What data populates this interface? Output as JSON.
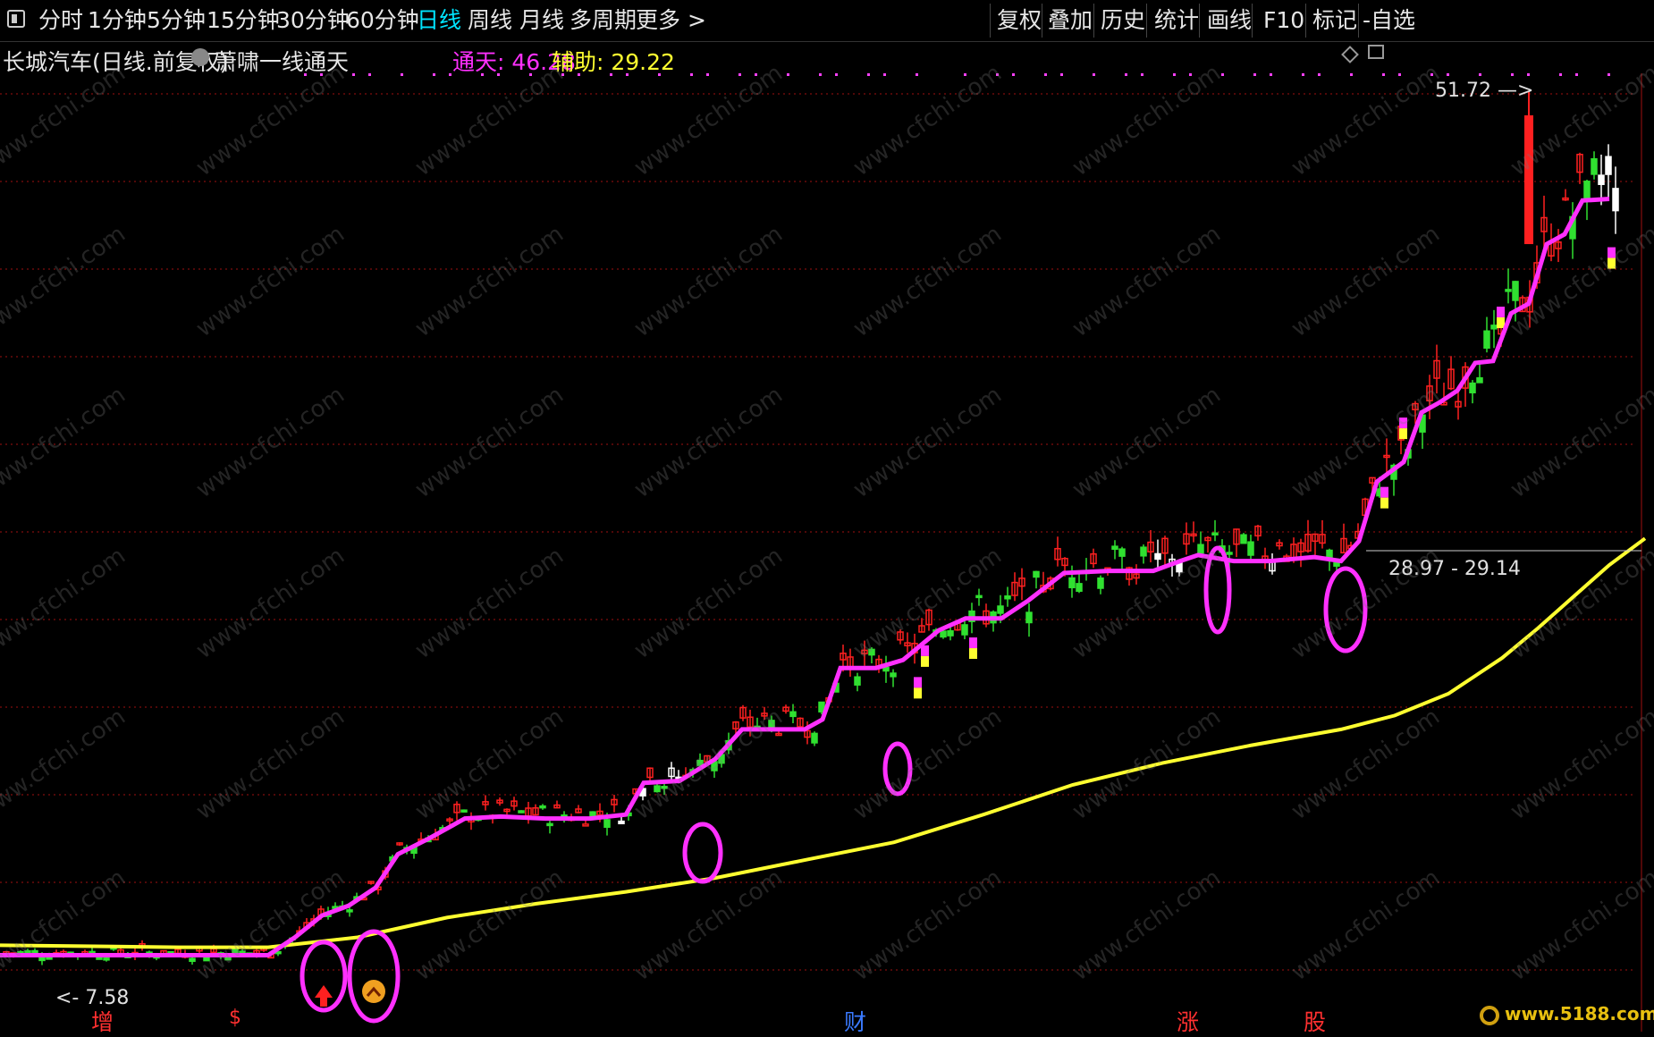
{
  "toolbar": {
    "periods": [
      "分时",
      "1分钟",
      "5分钟",
      "15分钟",
      "30分钟",
      "60分钟",
      "日线",
      "周线",
      "月线",
      "多周期",
      "更多 >"
    ],
    "active_period": "日线",
    "tools": [
      "复权",
      "叠加",
      "历史",
      "统计",
      "画线",
      "F10",
      "标记",
      "-自选"
    ]
  },
  "info": {
    "stock": "长城汽车(日线.前复权)",
    "indicator": "萧啸一线通天",
    "tongtian_label": "通天: 46.28",
    "fuzhu_label": "辅助: 29.22"
  },
  "colors": {
    "background": "#000000",
    "up": "#ff2020",
    "down": "#30e030",
    "flat": "#ffffff",
    "line_tongtian": "#ff30ff",
    "line_fuzhu": "#ffff30",
    "grid": "#a01010",
    "active_period": "#00e5ff"
  },
  "chart_data": {
    "type": "candlestick",
    "indicator_lines": [
      {
        "name": "通天",
        "last": 46.28
      },
      {
        "name": "辅助",
        "last": 29.22
      }
    ],
    "annotations": {
      "high_label": "51.72",
      "low_label": "7.58",
      "range_label": "28.97 - 29.14"
    },
    "event_markers": [
      {
        "text": "增",
        "color": "#ff3030"
      },
      {
        "text": "$",
        "color": "#ff3030"
      },
      {
        "text": "财",
        "color": "#3a7aff"
      },
      {
        "text": "涨",
        "color": "#ff3030"
      },
      {
        "text": "股",
        "color": "#ff3030"
      }
    ]
  },
  "watermark": "www.cfchi.com",
  "corner_logo": "www.5188.com"
}
